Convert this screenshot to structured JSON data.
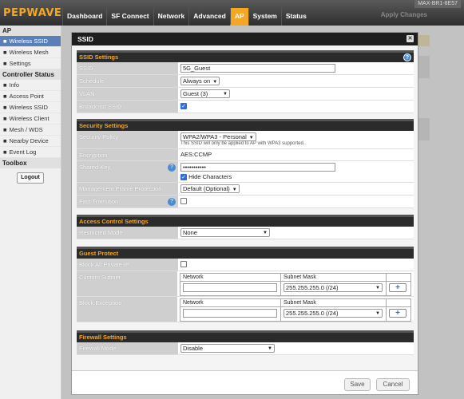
{
  "brand": "PEPWAVE",
  "device": "MAX-BR1-8E57",
  "nav": [
    "Dashboard",
    "SF Connect",
    "Network",
    "Advanced",
    "AP",
    "System",
    "Status"
  ],
  "apply_label": "Apply Changes",
  "sidebar": {
    "ap_head": "AP",
    "ap_items": [
      "Wireless SSID",
      "Wireless Mesh",
      "Settings"
    ],
    "ctrl_head": "Controller Status",
    "ctrl_items": [
      "Info",
      "Access Point",
      "Wireless SSID",
      "Wireless Client",
      "Mesh / WDS",
      "Nearby Device",
      "Event Log"
    ],
    "toolbox_head": "Toolbox",
    "logout": "Logout"
  },
  "modal": {
    "title": "SSID",
    "ssid_settings": {
      "head": "SSID Settings",
      "ssid_label": "SSID",
      "ssid_value": "5G_Guest",
      "schedule_label": "Schedule",
      "schedule_value": "Always on",
      "vlan_label": "VLAN",
      "vlan_value": "Guest (3)",
      "broadcast_label": "Broadcast SSID"
    },
    "security": {
      "head": "Security Settings",
      "policy_label": "Security Policy",
      "policy_value": "WPA2/WPA3 - Personal",
      "policy_note": "This SSID will only be applied to AP with WPA3 supported.",
      "enc_label": "Encryption",
      "enc_value": "AES:CCMP",
      "key_label": "Shared Key",
      "key_value": "•••••••••••",
      "hide_label": "Hide Characters",
      "mfp_label": "Management Frame Protection",
      "mfp_value": "Default (Optional)",
      "ft_label": "Fast Transition"
    },
    "access": {
      "head": "Access Control Settings",
      "mode_label": "Restricted Mode",
      "mode_value": "None"
    },
    "guest": {
      "head": "Guest Protect",
      "block_label": "Block All Private IP",
      "subnet_label": "Custom Subnet",
      "exception_label": "Block Exception",
      "col_network": "Network",
      "col_mask": "Subnet Mask",
      "mask_value": "255.255.255.0 (/24)"
    },
    "firewall": {
      "head": "Firewall Settings",
      "mode_label": "Firewall Mode",
      "mode_value": "Disable"
    },
    "save": "Save",
    "cancel": "Cancel"
  }
}
